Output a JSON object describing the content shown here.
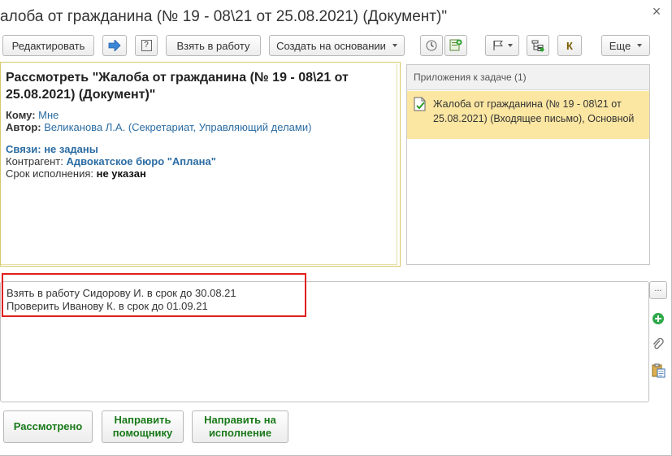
{
  "window": {
    "title": "алоба от гражданина (№ 19 - 08\\21 от 25.08.2021) (Документ)\"",
    "close_glyph": "×"
  },
  "toolbar": {
    "edit_label": "Редактировать",
    "take_label": "Взять в работу",
    "create_based_label": "Создать на основании",
    "more_label": "Еще",
    "k_label": "К",
    "help_label": "?"
  },
  "task": {
    "heading": "Рассмотреть \"Жалоба от гражданина (№ 19 - 08\\21 от 25.08.2021) (Документ)\"",
    "to_label": "Кому:",
    "to_value": "Мне",
    "author_label": "Автор:",
    "author_value": "Великанова Л.А. (Секретариат, Управляющий делами)",
    "links_label": "Связи:",
    "links_value": "не заданы",
    "contractor_label": "Контрагент:",
    "contractor_value": "Адвокатское бюро \"Аплана\"",
    "deadline_label": "Срок исполнения:",
    "deadline_value": "не указан"
  },
  "attachments": {
    "header": "Приложения к задаче (1)",
    "items": [
      {
        "text": "Жалоба от гражданина (№ 19 - 08\\21 от 25.08.2021) (Входящее письмо), Основной"
      }
    ]
  },
  "comment": {
    "line1": "Взять в работу Сидорову И. в срок до 30.08.21",
    "line2": "Проверить Иванову К. в срок до 01.09.21",
    "more_label": "..."
  },
  "actions": {
    "reviewed_label": "Рассмотрено",
    "send_assistant_label": "Направить помощнику",
    "send_execution_label": "Направить на исполнение"
  },
  "colors": {
    "accent_green": "#1a7a1a",
    "link_blue": "#2b6ca3",
    "highlight_yellow": "#fbe6a2",
    "annotation_red": "#e0201e"
  }
}
